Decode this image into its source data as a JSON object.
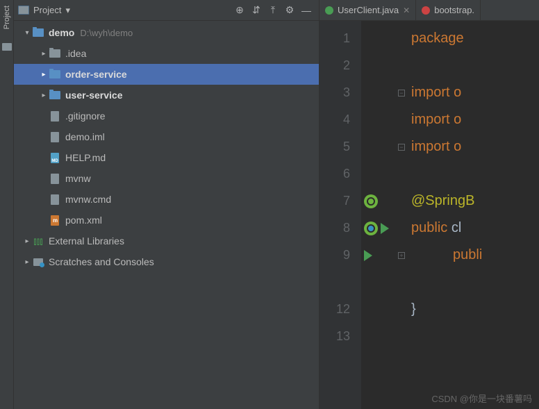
{
  "sidebar": {
    "label": "Project"
  },
  "header": {
    "title": "Project"
  },
  "tree": {
    "root": {
      "name": "demo",
      "path": "D:\\wyh\\demo"
    },
    "children": [
      {
        "name": ".idea",
        "type": "folder"
      },
      {
        "name": "order-service",
        "type": "module",
        "selected": true
      },
      {
        "name": "user-service",
        "type": "module"
      },
      {
        "name": ".gitignore",
        "type": "file"
      },
      {
        "name": "demo.iml",
        "type": "file"
      },
      {
        "name": "HELP.md",
        "type": "md"
      },
      {
        "name": "mvnw",
        "type": "sh"
      },
      {
        "name": "mvnw.cmd",
        "type": "file"
      },
      {
        "name": "pom.xml",
        "type": "xml"
      }
    ],
    "external": "External Libraries",
    "scratches": "Scratches and Consoles"
  },
  "tabs": [
    {
      "name": "UserClient.java",
      "icon": "interface"
    },
    {
      "name": "bootstrap.",
      "icon": "yml"
    }
  ],
  "code": {
    "lines": [
      "1",
      "2",
      "3",
      "4",
      "5",
      "6",
      "7",
      "8",
      "9",
      "",
      "12",
      "13"
    ],
    "l1": "package ",
    "l3": "import o",
    "l4": "import o",
    "l5": "import o",
    "l7": "@SpringB",
    "l8a": "public ",
    "l8b": "cl",
    "l9": "publi",
    "l12": "}"
  },
  "watermark": "CSDN @你是一块番薯吗"
}
